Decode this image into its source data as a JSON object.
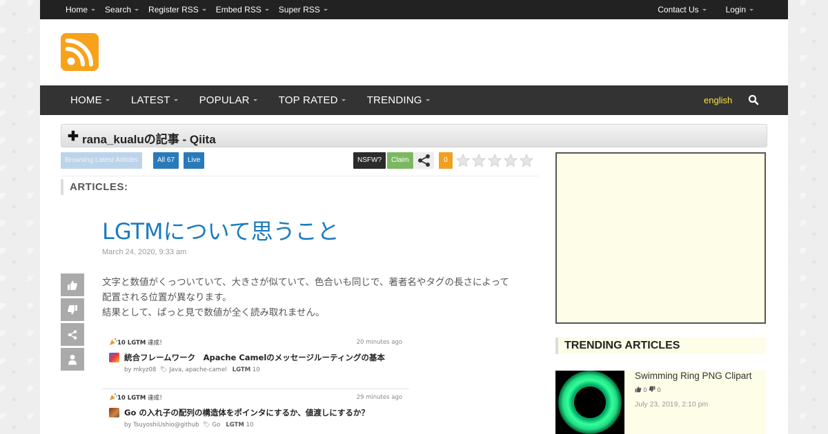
{
  "topbar": {
    "left": [
      "Home",
      "Search",
      "Register RSS",
      "Embed RSS",
      "Super RSS"
    ],
    "right": [
      "Contact Us",
      "Login"
    ]
  },
  "mainnav": {
    "items": [
      "HOME",
      "LATEST",
      "POPULAR",
      "TOP RATED",
      "TRENDING"
    ],
    "language": "english"
  },
  "feed": {
    "title": "rana_kualuの記事 - Qiita"
  },
  "toolbar": {
    "browsing": "Browsing Latest Articles",
    "all": "All 67",
    "live": "Live",
    "nsfw": "NSFW?",
    "claim": "Claim",
    "count": "0",
    "rating_stars": 0,
    "rating_max": 5
  },
  "section": {
    "articles_heading": "ARTICLES:"
  },
  "article": {
    "title": "LGTMについて思うこと",
    "date": "March 24, 2020, 9:33 am",
    "body": [
      "文字と数値がくっついていて、大きさが似ていて、色合いも同じで、著者名やタグの長さによって",
      "配置される位置が異なります。",
      "結果として、ぱっと見で数値が全く読み取れません。"
    ]
  },
  "qiita_feed": [
    {
      "notice": "10 LGTM",
      "notice_suffix": "達成！",
      "ago": "20 minutes ago",
      "title": "統合フレームワーク　Apache Camelのメッセージルーティングの基本",
      "author": "by mkyz08",
      "tags": "Java, apache-camel",
      "lgtm_label": "LGTM",
      "lgtm_count": "10"
    },
    {
      "notice": "10 LGTM",
      "notice_suffix": "達成！",
      "ago": "29 minutes ago",
      "title": "Go の入れ子の配列の構造体をポインタにするか、値渡しにするか？",
      "author": "by TsuyoshiUshio@github",
      "tags": "Go",
      "lgtm_label": "LGTM",
      "lgtm_count": "10"
    }
  ],
  "trending": {
    "heading": "TRENDING ARTICLES",
    "items": [
      {
        "title": "Swimming Ring PNG Clipart",
        "up": "0",
        "down": "0",
        "date": "July 23, 2019, 2:10 pm"
      }
    ]
  },
  "colors": {
    "accent_blue": "#1a7ac0",
    "rss_orange": "#f7a21b",
    "lang_yellow": "#f7e23b",
    "badge_blue": "#2a7ab8",
    "badge_green": "#7cb861",
    "badge_orange": "#f0a020"
  }
}
